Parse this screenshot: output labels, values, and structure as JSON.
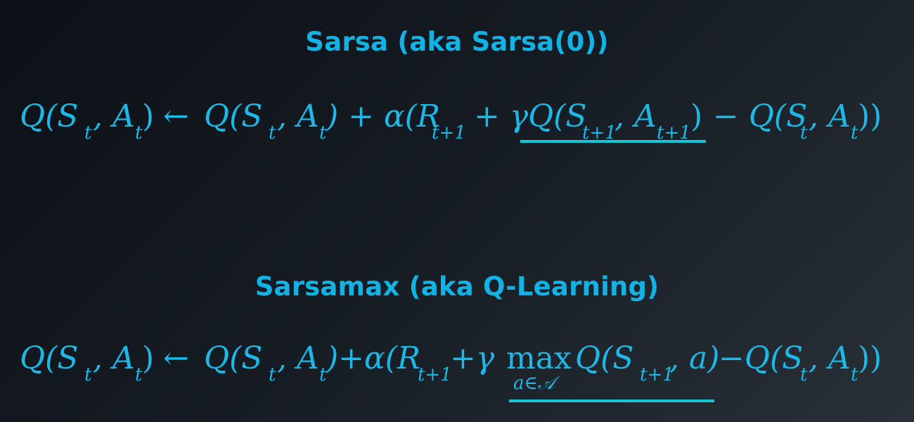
{
  "sections": [
    {
      "title": "Sarsa (aka Sarsa(0))",
      "equation": "Q(S_t, A_t) ← Q(S_t, A_t) + α(R_{t+1} + γQ(S_{t+1}, A_{t+1}) − Q(S_t, A_t))"
    },
    {
      "title": "Sarsamax (aka Q-Learning)",
      "equation": "Q(S_t, A_t) ← Q(S_t, A_t) + α(R_{t+1} + γ max_{a∈A} Q(S_{t+1}, a) − Q(S_t, A_t))"
    }
  ],
  "eq1": {
    "lhs": "Q(S",
    "t1": "t",
    "lhs2": ", A",
    "t2": "t",
    "lhs3": ")",
    "arrow": "←",
    "r1": "Q(S",
    "rt1": "t",
    "r2": ", A",
    "rt2": "t",
    "r3": ") + α(R",
    "rsub": "t+1",
    "r4": " + γQ(S",
    "rsub2": "t+1",
    "r5": ", A",
    "rsub3": "t+1",
    "r6": ")",
    "r7": " − Q(S",
    "rt3": "t",
    "r8": ", A",
    "rt4": "t",
    "r9": "))"
  },
  "eq2": {
    "lhs": "Q(S",
    "t1": "t",
    "lhs2": ", A",
    "t2": "t",
    "lhs3": ")",
    "arrow": "←",
    "r1": "Q(S",
    "rt1": "t",
    "r2": ", A",
    "rt2": "t",
    "r3": ")+α(R",
    "rsub": "t+1",
    "r4": "+γ",
    "max": "max",
    "maxsub": "a∈𝒜",
    "r5": "Q(S",
    "rsub2": "t+1",
    "r6": ", a)",
    "r7": "−Q(S",
    "rt3": "t",
    "r8": ", A",
    "rt4": "t",
    "r9": "))"
  },
  "colors": {
    "heading": "#12b2e4",
    "math": "#1eb8e6",
    "underline": "#15c6d6",
    "background": "#151b22"
  }
}
